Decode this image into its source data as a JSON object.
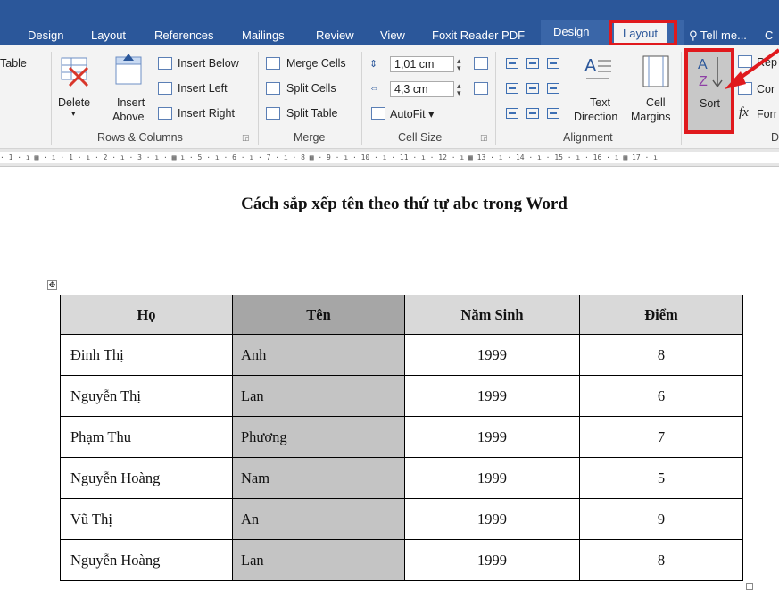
{
  "tabs": {
    "design": "Design",
    "layout": "Layout",
    "references": "References",
    "mailings": "Mailings",
    "review": "Review",
    "view": "View",
    "foxit": "Foxit Reader PDF",
    "table_design": "Design",
    "table_layout": "Layout",
    "tell_me": "Tell me...",
    "cutoff": "C"
  },
  "ribbon": {
    "table_partial": "Table",
    "delete": "Delete",
    "insert_line1": "Insert",
    "insert_line2": "Above",
    "insert_below": "Insert Below",
    "insert_left": "Insert Left",
    "insert_right": "Insert Right",
    "rows_columns_label": "Rows & Columns",
    "merge_cells": "Merge Cells",
    "split_cells": "Split Cells",
    "split_table": "Split Table",
    "merge_label": "Merge",
    "height_value": "1,01 cm",
    "width_value": "4,3 cm",
    "autofit": "AutoFit",
    "cell_size_label": "Cell Size",
    "text_direction_line1": "Text",
    "text_direction_line2": "Direction",
    "cell_margins_line1": "Cell",
    "cell_margins_line2": "Margins",
    "alignment_label": "Alignment",
    "sort": "Sort",
    "repeat_partial": "Rep",
    "convert_partial": "Cor",
    "formula_partial": "Forr",
    "data_label_partial": "D",
    "fx": "fx"
  },
  "ruler": {
    "text": "· 1 · ı ▦  · ı · 1 · ı · 2 · ı · 3 · ı · ▦ ı · 5 · ı · 6 · ı · 7 · ı · 8 ▦  · 9 · ı · 10 · ı · 11 · ı · 12 · ı ▦ 13 · ı · 14 · ı · 15 · ı · 16 · ı ▦ 17 · ı"
  },
  "document": {
    "title": "Cách sắp xếp tên theo thứ tự abc trong Word",
    "headers": [
      "Họ",
      "Tên",
      "Năm Sinh",
      "Điểm"
    ],
    "rows": [
      [
        "Đinh Thị",
        "Anh",
        "1999",
        "8"
      ],
      [
        "Nguyễn Thị",
        "Lan",
        "1999",
        "6"
      ],
      [
        "Phạm Thu",
        "Phương",
        "1999",
        "7"
      ],
      [
        "Nguyễn Hoàng",
        "Nam",
        "1999",
        "5"
      ],
      [
        "Vũ Thị",
        "An",
        "1999",
        "9"
      ],
      [
        "Nguyễn Hoàng",
        "Lan",
        "1999",
        "8"
      ]
    ]
  },
  "colors": {
    "ribbon_blue": "#2b579a",
    "highlight_red": "#e0191d",
    "selected_column": "#c4c4c4"
  }
}
